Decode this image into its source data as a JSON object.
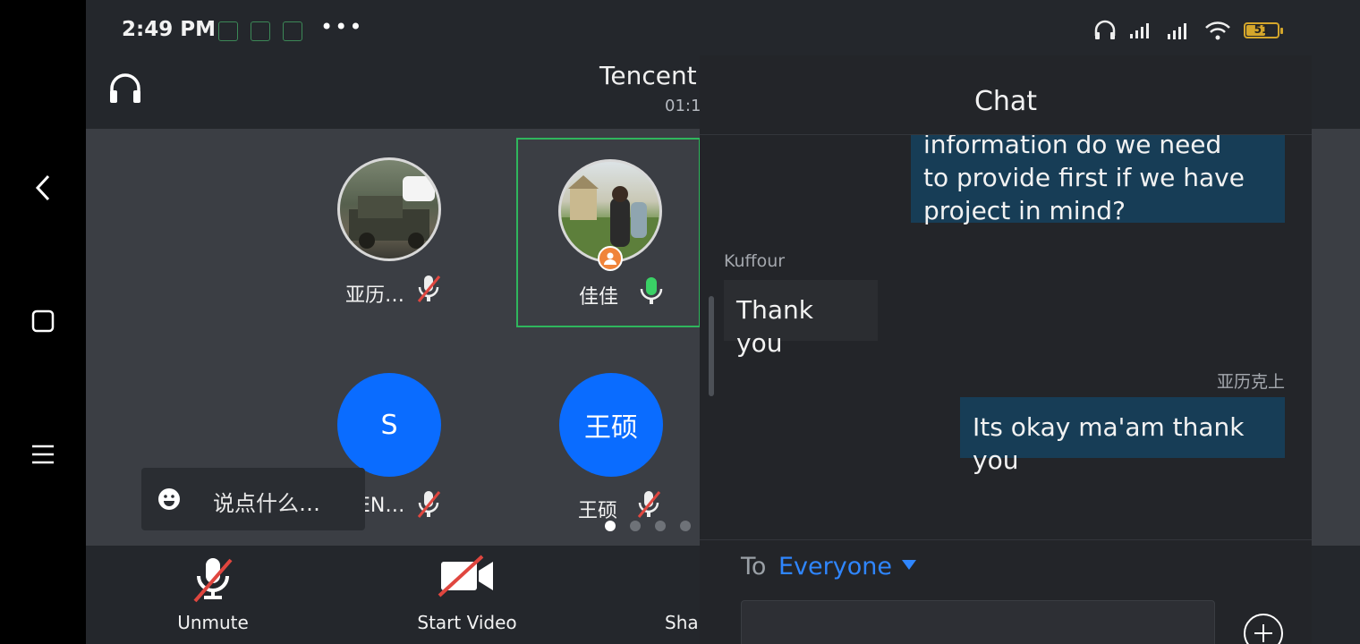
{
  "status_bar": {
    "time": "2:49 PM",
    "dots": "•••",
    "battery_level": "51"
  },
  "meeting": {
    "title": "Tencent",
    "timer": "01:1"
  },
  "participants": [
    {
      "name": "亚历…",
      "mic": "muted"
    },
    {
      "name": "佳佳",
      "mic": "active",
      "avatar_text": ""
    },
    {
      "name": "SEN…",
      "mic": "muted",
      "avatar_text": "S"
    },
    {
      "name": "王硕",
      "mic": "muted",
      "avatar_text": "王硕"
    }
  ],
  "comment": {
    "placeholder": "说点什么…"
  },
  "toolbar": {
    "unmute": "Unmute",
    "start_video": "Start Video",
    "share": "Shar"
  },
  "chat": {
    "title": "Chat",
    "messages": [
      {
        "sender": "",
        "text_lines": [
          "information do we need",
          "to provide first if we have",
          "project in mind?"
        ],
        "direction": "out"
      },
      {
        "sender": "Kuffour",
        "text": "Thank you",
        "direction": "in"
      },
      {
        "sender": "亚历克上",
        "text": "Its okay ma'am thank you",
        "direction": "out"
      }
    ],
    "to_label": "To",
    "to_target": "Everyone"
  },
  "colors": {
    "accent": "#2f86ff",
    "selected_border": "#2fb65d",
    "avatar_blue": "#0a6cff",
    "muted_slash": "#e0463f"
  }
}
